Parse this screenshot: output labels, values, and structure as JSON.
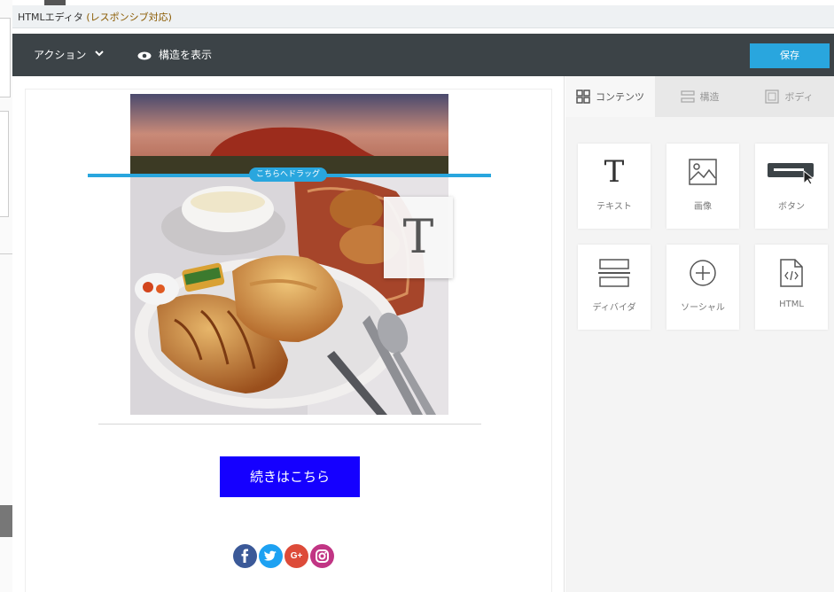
{
  "window": {
    "title": "HTMLエディタ",
    "title_suffix": "(レスポンシブ対応)"
  },
  "toolbar": {
    "action_label": "アクション",
    "structure_label": "構造を表示",
    "save_label": "保存"
  },
  "canvas": {
    "drop_hint": "こちらへドラッグ",
    "drag_ghost_glyph": "T",
    "cta_label": "続きはこちら",
    "social": [
      "f",
      "t",
      "G+",
      "ig"
    ]
  },
  "panel": {
    "tabs": [
      {
        "label": "コンテンツ",
        "icon": "grid-icon",
        "active": true
      },
      {
        "label": "構造",
        "icon": "rows-icon",
        "active": false
      },
      {
        "label": "ボディ",
        "icon": "body-icon",
        "active": false
      }
    ],
    "tiles": [
      {
        "label": "テキスト",
        "icon": "text-icon",
        "glyph": "T"
      },
      {
        "label": "画像",
        "icon": "image-icon"
      },
      {
        "label": "ボタン",
        "icon": "button-icon"
      },
      {
        "label": "ディバイダ",
        "icon": "divider-icon"
      },
      {
        "label": "ソーシャル",
        "icon": "social-plus-icon"
      },
      {
        "label": "HTML",
        "icon": "html-icon"
      }
    ]
  },
  "colors": {
    "toolbar_bg": "#3c4347",
    "accent": "#29a6de",
    "cta": "#1500ff"
  }
}
